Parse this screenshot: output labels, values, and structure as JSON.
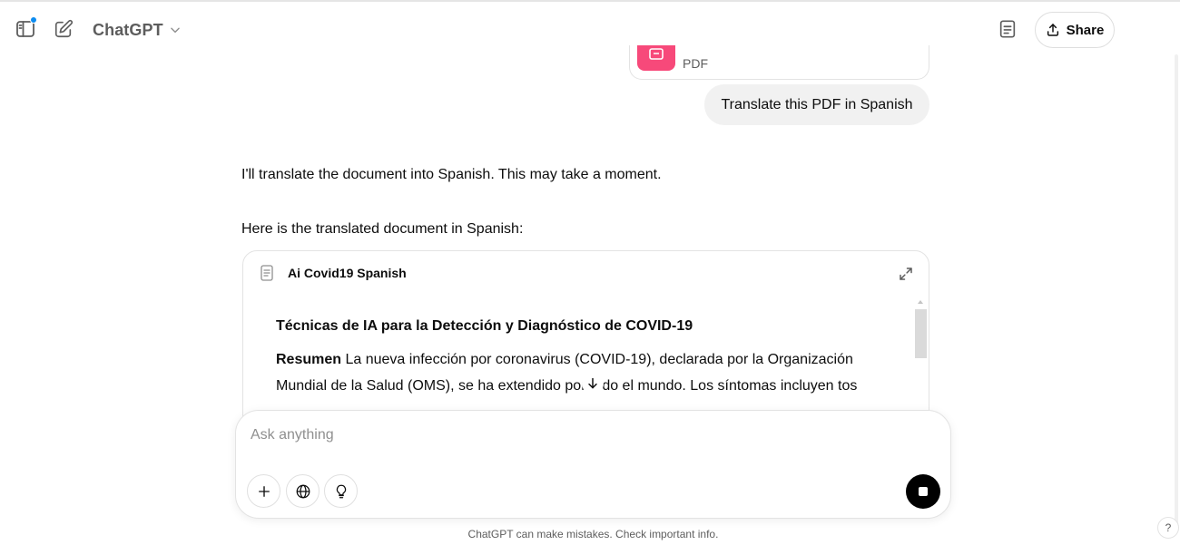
{
  "header": {
    "model_name": "ChatGPT",
    "share_label": "Share"
  },
  "conversation": {
    "attachment": {
      "type_label": "PDF"
    },
    "user_message": "Translate this PDF in Spanish",
    "assistant_intro": "I'll translate the document into Spanish. This may take a moment.",
    "assistant_lead": "Here is the translated document in Spanish:",
    "document": {
      "title": "Ai Covid19 Spanish",
      "heading": "Técnicas de IA para la Detección y Diagnóstico de COVID-19",
      "abstract_label": "Resumen",
      "abstract_text": "La nueva infección por coronavirus (COVID-19), declarada por la Organización Mundial de la Salud (OMS), se ha extendido por todo el mundo. Los síntomas incluyen tos"
    }
  },
  "composer": {
    "placeholder": "Ask anything"
  },
  "footer": {
    "disclaimer": "ChatGPT can make mistakes. Check important info.",
    "help_label": "?"
  },
  "colors": {
    "pdf_badge": "#f7497a",
    "notification_dot": "#0d8cf0",
    "user_bubble": "#f1f1f1",
    "stop_button": "#000000"
  },
  "icons": {
    "sidebar": "sidebar-toggle-icon",
    "new_chat": "pencil-square-icon",
    "model_menu": "chevron-down-icon",
    "canvas": "document-icon",
    "share": "upload-icon",
    "expand": "expand-arrows-icon",
    "scroll_down": "arrow-down-icon",
    "attach": "plus-icon",
    "search": "globe-icon",
    "reason": "lightbulb-icon",
    "stop": "stop-icon"
  }
}
